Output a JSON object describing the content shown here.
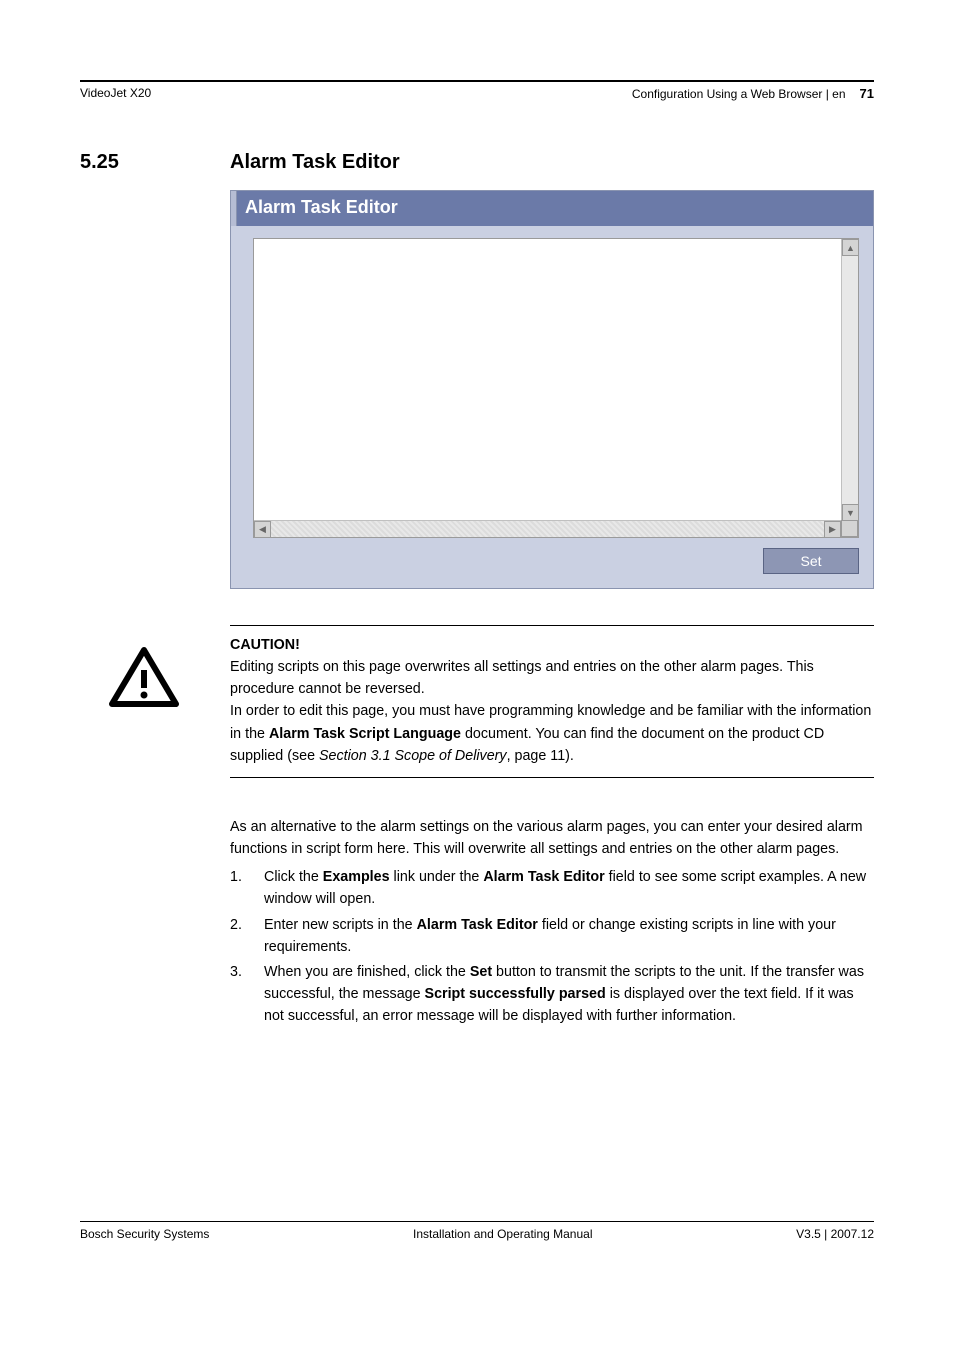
{
  "header": {
    "product": "VideoJet X20",
    "chapter": "Configuration Using a Web Browser | en",
    "page_number": "71"
  },
  "section": {
    "number": "5.25",
    "title": "Alarm Task Editor"
  },
  "editor": {
    "panel_title": "Alarm Task Editor",
    "set_button": "Set"
  },
  "caution": {
    "heading": "CAUTION!",
    "line1": "Editing scripts on this page overwrites all settings and entries on the other alarm pages. This procedure cannot be reversed.",
    "line2a": "In order to edit this page, you must have programming knowledge and be familiar with the information in the ",
    "line2_bold": "Alarm Task Script Language",
    "line2b": " document. You can find the document on the product CD supplied (see ",
    "line2_italic": "Section 3.1 Scope of Delivery",
    "line2c": ", page 11)."
  },
  "intro": "As an alternative to the alarm settings on the various alarm pages, you can enter your desired alarm functions in script form here. This will overwrite all settings and entries on the other alarm pages.",
  "steps": {
    "s1a": "Click the ",
    "s1_b1": "Examples",
    "s1b": " link under the ",
    "s1_b2": "Alarm Task Editor",
    "s1c": " field to see some script examples. A new window will open.",
    "s2a": "Enter new scripts in the ",
    "s2_b1": "Alarm Task Editor",
    "s2b": " field or change existing scripts in line with your requirements.",
    "s3a": "When you are finished, click the ",
    "s3_b1": "Set",
    "s3b": " button to transmit the scripts to the unit. If the transfer was successful, the message ",
    "s3_b2": "Script successfully parsed",
    "s3c": " is displayed over the text field. If it was not successful, an error message will be displayed with further information."
  },
  "footer": {
    "left": "Bosch Security Systems",
    "center": "Installation and Operating Manual",
    "right": "V3.5 | 2007.12"
  }
}
